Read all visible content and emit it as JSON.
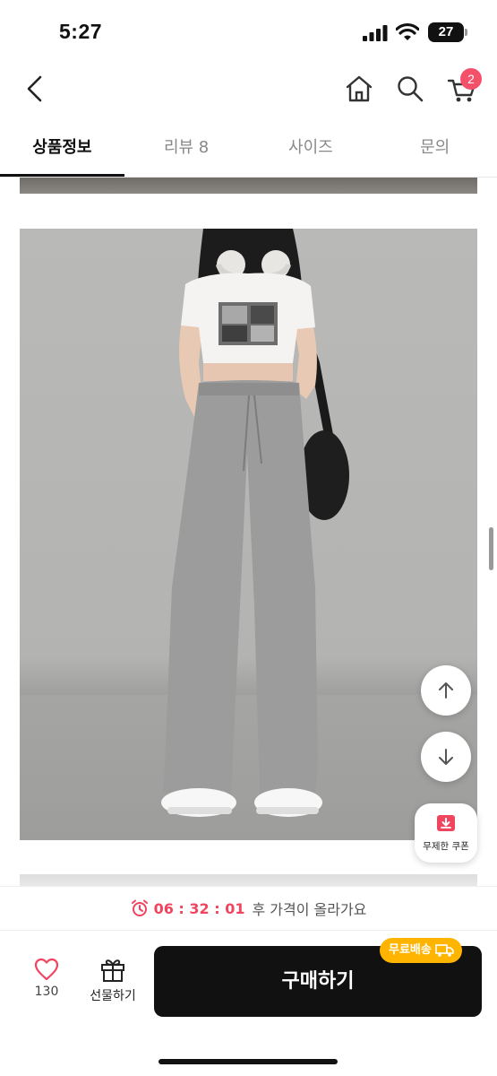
{
  "status_bar": {
    "time": "5:27",
    "battery": "27"
  },
  "nav": {
    "cart_count": "2"
  },
  "tabs": [
    {
      "label": "상품정보",
      "active": true
    },
    {
      "label": "리뷰 8",
      "active": false
    },
    {
      "label": "사이즈",
      "active": false
    },
    {
      "label": "문의",
      "active": false
    }
  ],
  "coupon": {
    "label": "무제한 쿠폰"
  },
  "timer": {
    "countdown": "06 : 32 : 01",
    "suffix": "후 가격이 올라가요"
  },
  "actions": {
    "like_count": "130",
    "gift_label": "선물하기",
    "buy_label": "구매하기",
    "shipping_badge": "무료배송"
  },
  "colors": {
    "accent": "#f4506a",
    "timer": "#f0455f",
    "badge": "#ffb400",
    "buy_button": "#111111"
  }
}
